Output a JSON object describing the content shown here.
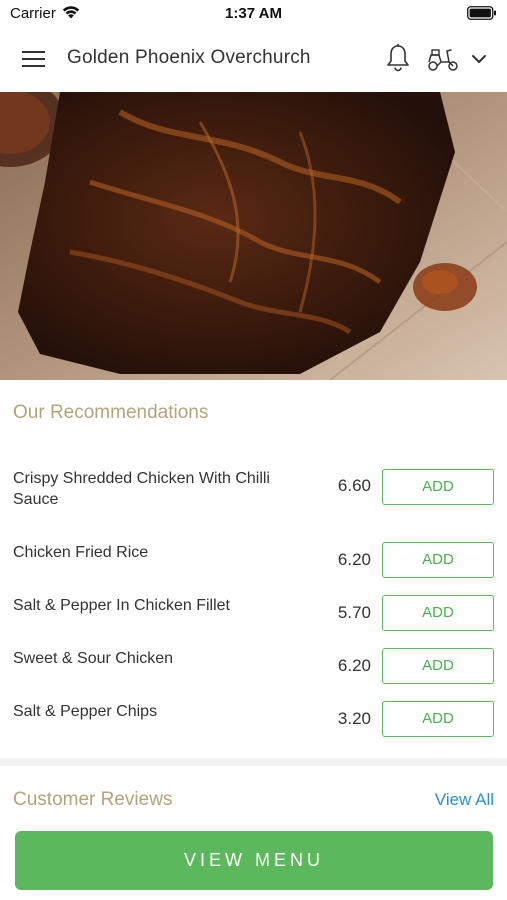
{
  "status_bar": {
    "carrier": "Carrier",
    "time": "1:37 AM"
  },
  "header": {
    "title": "Golden Phoenix Overchurch",
    "icons": [
      "menu-icon",
      "bell-icon",
      "scooter-icon",
      "chevron-down-icon"
    ]
  },
  "recommendations": {
    "title": "Our Recommendations",
    "items": [
      {
        "name": "Crispy Shredded Chicken With Chilli Sauce",
        "price": "6.60",
        "button": "ADD"
      },
      {
        "name": "Chicken Fried Rice",
        "price": "6.20",
        "button": "ADD"
      },
      {
        "name": "Salt & Pepper In Chicken Fillet",
        "price": "5.70",
        "button": "ADD"
      },
      {
        "name": "Sweet & Sour Chicken",
        "price": "6.20",
        "button": "ADD"
      },
      {
        "name": "Salt & Pepper Chips",
        "price": "3.20",
        "button": "ADD"
      }
    ]
  },
  "reviews": {
    "title": "Customer Reviews",
    "view_all": "View All"
  },
  "footer": {
    "view_menu": "VIEW MENU"
  },
  "colors": {
    "accent_green": "#5cb85c",
    "section_title": "#b4a47a",
    "link_blue": "#2a8fd6"
  }
}
